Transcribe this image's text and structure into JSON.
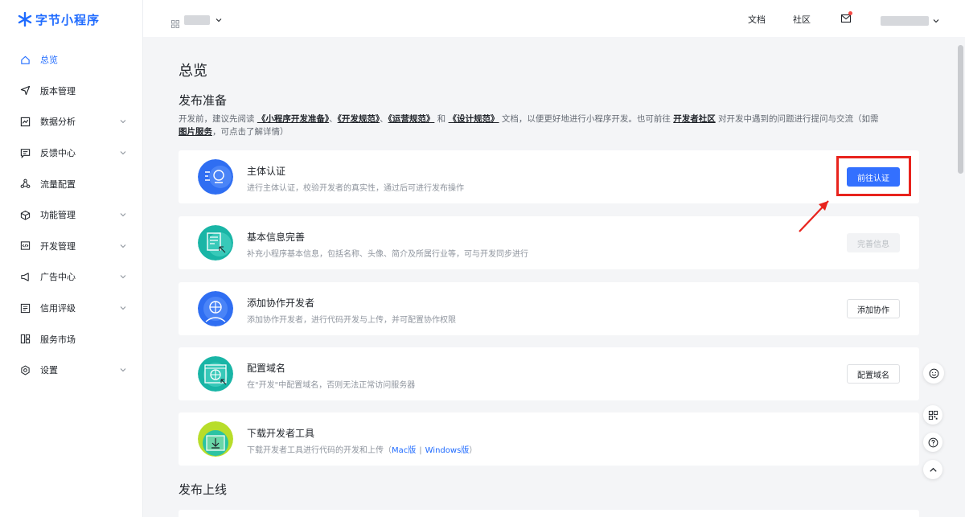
{
  "app": {
    "name": "字节小程序"
  },
  "sidebar": {
    "items": [
      {
        "label": "总览",
        "icon": "home-icon",
        "active": true,
        "expandable": false
      },
      {
        "label": "版本管理",
        "icon": "send-icon",
        "active": false,
        "expandable": false
      },
      {
        "label": "数据分析",
        "icon": "chart-icon",
        "active": false,
        "expandable": true
      },
      {
        "label": "反馈中心",
        "icon": "message-icon",
        "active": false,
        "expandable": true
      },
      {
        "label": "流量配置",
        "icon": "share-icon",
        "active": false,
        "expandable": false
      },
      {
        "label": "功能管理",
        "icon": "cube-icon",
        "active": false,
        "expandable": true
      },
      {
        "label": "开发管理",
        "icon": "code-icon",
        "active": false,
        "expandable": true
      },
      {
        "label": "广告中心",
        "icon": "megaphone-icon",
        "active": false,
        "expandable": true
      },
      {
        "label": "信用评级",
        "icon": "rating-icon",
        "active": false,
        "expandable": true
      },
      {
        "label": "服务市场",
        "icon": "apps-icon",
        "active": false,
        "expandable": false
      },
      {
        "label": "设置",
        "icon": "gear-icon",
        "active": false,
        "expandable": true
      }
    ]
  },
  "header": {
    "docs": "文档",
    "community": "社区"
  },
  "main": {
    "title": "总览",
    "prep_title": "发布准备",
    "intro": {
      "t1": "开发前，建议先阅读 ",
      "l1": "《小程序开发准备》",
      "t2": "、",
      "l2": "《开发规范》",
      "t3": "、",
      "l3": "《运营规范》",
      "t4": " 和 ",
      "l4": "《设计规范》",
      "t5": " 文档，以便更好地进行小程序开发。也可前往 ",
      "l5": "开发者社区",
      "t6": " 对开发中遇到的问题进行提问与交流（如需",
      "l6": "图片服务",
      "t7": "，可点击了解详情）"
    },
    "cards": [
      {
        "title": "主体认证",
        "desc": "进行主体认证，校验开发者的真实性，通过后可进行发布操作",
        "button": "前往认证",
        "icon": "verify-icon"
      },
      {
        "title": "基本信息完善",
        "desc": "补充小程序基本信息，包括名称、头像、简介及所属行业等，可与开发同步进行",
        "button": "完善信息",
        "icon": "profile-doc-icon"
      },
      {
        "title": "添加协作开发者",
        "desc": "添加协作开发者，进行代码开发与上传，并可配置协作权限",
        "button": "添加协作",
        "icon": "collaborator-icon"
      },
      {
        "title": "配置域名",
        "desc": "在\"开发\"中配置域名，否则无法正常访问服务器",
        "button": "配置域名",
        "icon": "globe-icon"
      },
      {
        "title": "下载开发者工具",
        "desc": "下载开发者工具进行代码的开发和上传（",
        "mac": "Mac版",
        "sep": "|",
        "windows": "Windows版",
        "desc_end": "）",
        "icon": "download-icon"
      }
    ],
    "publish_title": "发布上线"
  },
  "colors": {
    "primary": "#3370ff",
    "highlight": "#e8231d",
    "text": "#1f2329",
    "muted": "#8f959e"
  }
}
